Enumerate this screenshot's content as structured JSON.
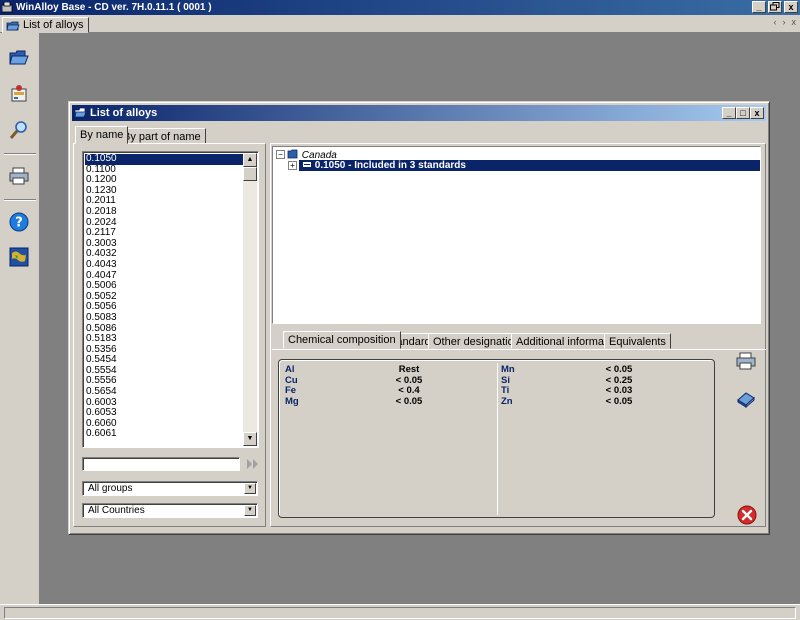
{
  "app": {
    "title": "WinAlloy Base - CD ver. 7H.0.11.1 ( 0001 )",
    "window_buttons": [
      "_",
      "Œ",
      "x"
    ],
    "doc_tab": "List of alloys",
    "nav_arrows": [
      "‹",
      "›",
      "x"
    ]
  },
  "toolbar": {
    "icons": [
      "open-folder-icon",
      "alloy-editor-icon",
      "search-icon",
      "print-icon",
      "help-icon",
      "world-map-icon"
    ]
  },
  "dialog": {
    "title": "List of alloys",
    "buttons": [
      "_",
      "□",
      "x"
    ],
    "left_tabs": [
      "By name",
      "By part of name"
    ],
    "alloys": [
      "0.1050",
      "0.1100",
      "0.1200",
      "0.1230",
      "0.2011",
      "0.2018",
      "0.2024",
      "0.2117",
      "0.3003",
      "0.4032",
      "0.4043",
      "0.4047",
      "0.5006",
      "0.5052",
      "0.5056",
      "0.5083",
      "0.5086",
      "0.5183",
      "0.5356",
      "0.5454",
      "0.5554",
      "0.5556",
      "0.5654",
      "0.6003",
      "0.6053",
      "0.6060",
      "0.6061"
    ],
    "selected_alloy": "0.1050",
    "search_value": "",
    "groups_select": "All groups",
    "countries_select": "All Countries",
    "tree": {
      "country": "Canada",
      "entry": "0.1050  -  Included in 3 standards"
    },
    "detail_tabs": [
      "Chemical composition",
      "Standards",
      "Other designations",
      "Additional information",
      "Equivalents"
    ],
    "composition": {
      "left": [
        {
          "element": "Al",
          "value": "Rest"
        },
        {
          "element": "Cu",
          "value": "< 0.05"
        },
        {
          "element": "Fe",
          "value": "< 0.4"
        },
        {
          "element": "Mg",
          "value": "< 0.05"
        }
      ],
      "right": [
        {
          "element": "Mn",
          "value": "< 0.05"
        },
        {
          "element": "Si",
          "value": "< 0.25"
        },
        {
          "element": "Ti",
          "value": "< 0.03"
        },
        {
          "element": "Zn",
          "value": "< 0.05"
        }
      ]
    },
    "side_icons": [
      "print-icon",
      "eraser-icon",
      "close-icon"
    ]
  },
  "colors": {
    "accent": "#0a246a",
    "face": "#d4d0c8",
    "desktop": "#808080",
    "close_red": "#d42b2b"
  }
}
